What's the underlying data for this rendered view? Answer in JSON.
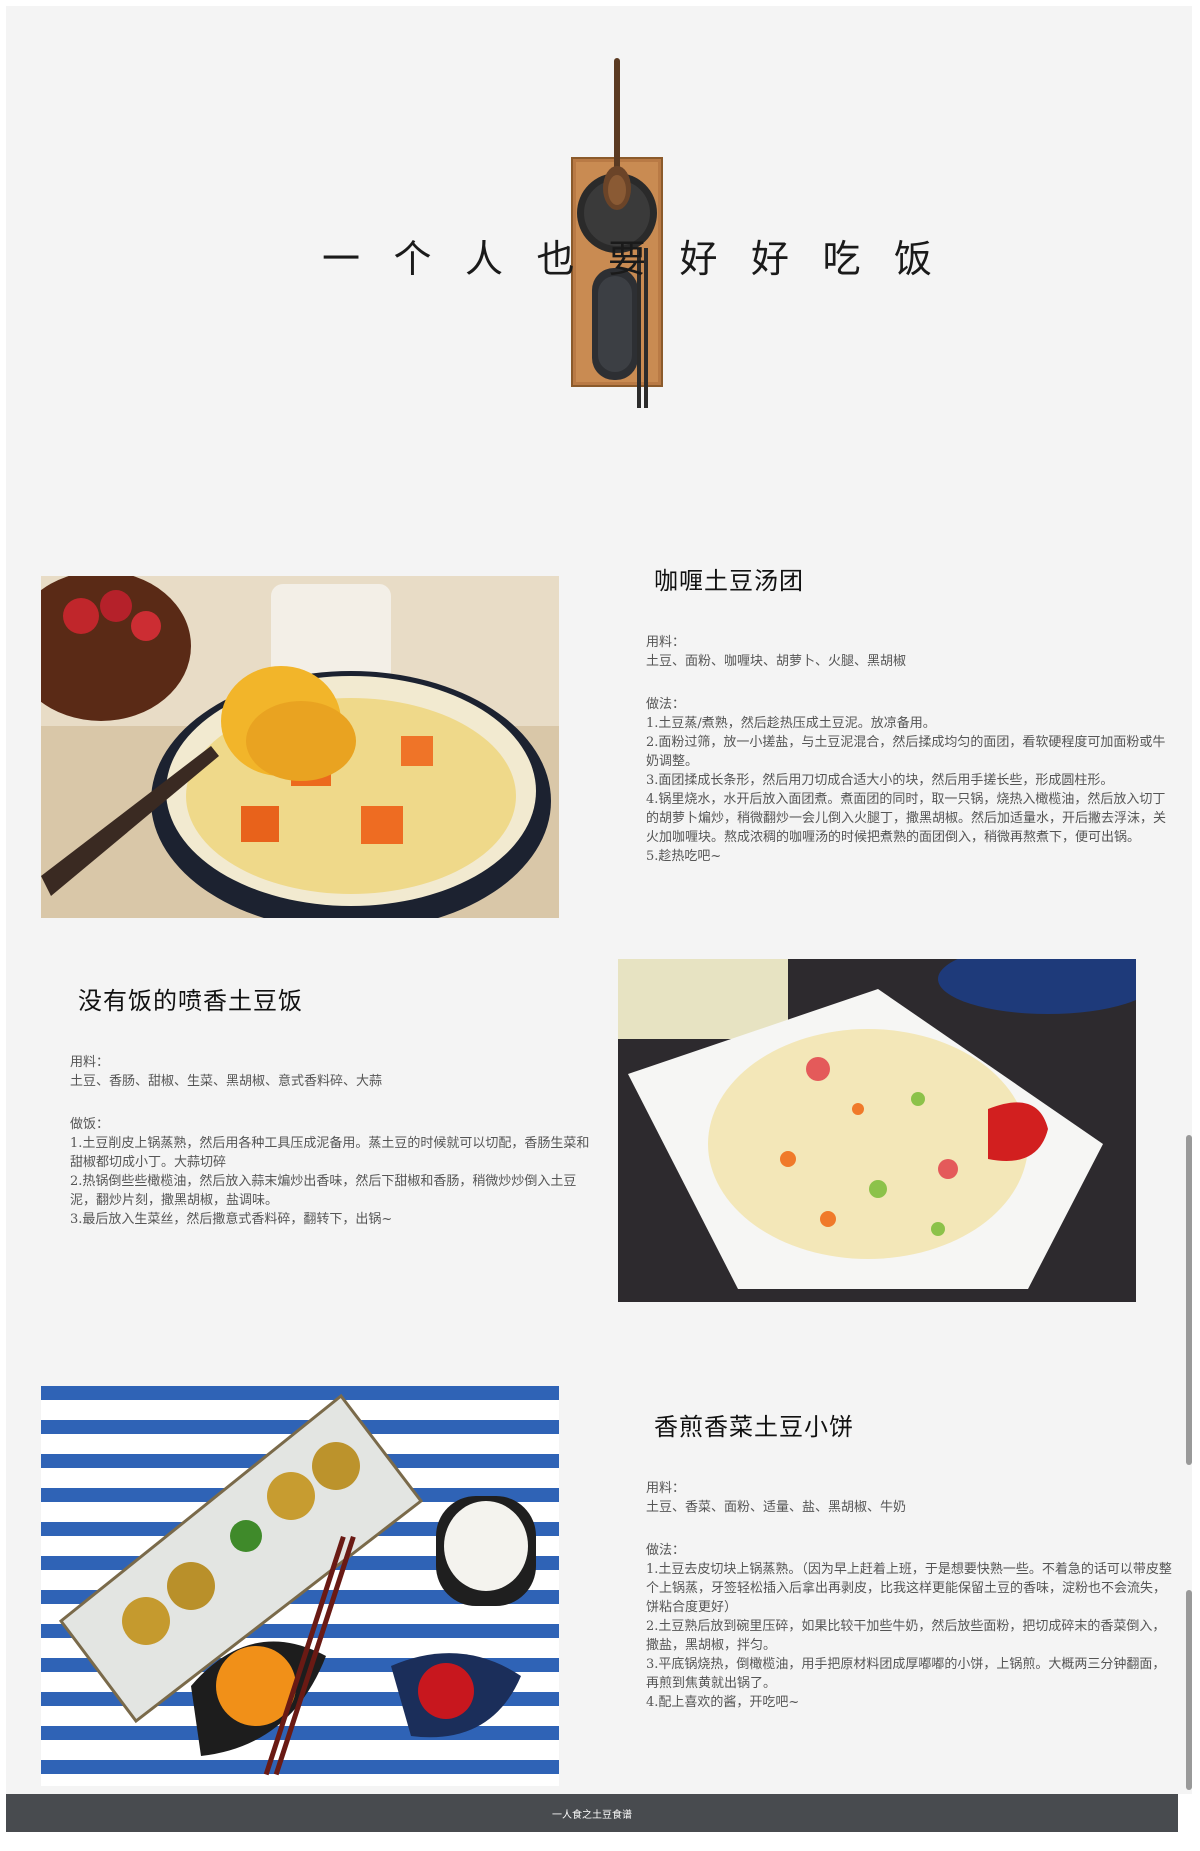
{
  "hero": {
    "title_chars": [
      "一",
      "个",
      "人",
      "也",
      "要",
      "好",
      "好",
      "吃",
      "饭"
    ]
  },
  "recipes": [
    {
      "title": "咖喱土豆汤团",
      "ingredients_label": "用料：",
      "ingredients": "土豆、面粉、咖喱块、胡萝卜、火腿、黑胡椒",
      "method_label": "做法：",
      "steps": [
        "1.土豆蒸/煮熟，然后趁热压成土豆泥。放凉备用。",
        "2.面粉过筛，放一小搓盐，与土豆泥混合，然后揉成均匀的面团，看软硬程度可加面粉或牛奶调整。",
        "3.面团揉成长条形，然后用刀切成合适大小的块，然后用手搓长些，形成圆柱形。",
        "4.锅里烧水，水开后放入面团煮。煮面团的同时，取一只锅，烧热入橄榄油，然后放入切丁的胡萝卜煸炒，稍微翻炒一会儿倒入火腿丁，撒黑胡椒。然后加适量水，开后撇去浮沫，关火加咖喱块。熬成浓稠的咖喱汤的时候把煮熟的面团倒入，稍微再熬煮下，便可出锅。",
        "5.趁热吃吧~"
      ]
    },
    {
      "title": "没有饭的喷香土豆饭",
      "ingredients_label": "用料：",
      "ingredients": "土豆、香肠、甜椒、生菜、黑胡椒、意式香料碎、大蒜",
      "method_label": "做饭：",
      "steps": [
        "1.土豆削皮上锅蒸熟，然后用各种工具压成泥备用。蒸土豆的时候就可以切配，香肠生菜和甜椒都切成小丁。大蒜切碎",
        "2.热锅倒些些橄榄油，然后放入蒜末煸炒出香味，然后下甜椒和香肠，稍微炒炒倒入土豆泥，翻炒片刻，撒黑胡椒，盐调味。",
        "3.最后放入生菜丝，然后撒意式香料碎，翻转下，出锅~"
      ]
    },
    {
      "title": "香煎香菜土豆小饼",
      "ingredients_label": "用料：",
      "ingredients": "土豆、香菜、面粉、适量、盐、黑胡椒、牛奶",
      "method_label": "做法：",
      "steps": [
        "1.土豆去皮切块上锅蒸熟。（因为早上赶着上班，于是想要快熟一些。不着急的话可以带皮整个上锅蒸，牙签轻松插入后拿出再剥皮，比我这样更能保留土豆的香味，淀粉也不会流失，饼粘合度更好）",
        "2.土豆熟后放到碗里压碎，如果比较干加些牛奶，然后放些面粉，把切成碎末的香菜倒入，撒盐，黑胡椒，拌匀。",
        "3.平底锅烧热，倒橄榄油，用手把原材料团成厚嘟嘟的小饼，上锅煎。大概两三分钟翻面，再煎到焦黄就出锅了。",
        "4.配上喜欢的酱，开吃吧~"
      ]
    }
  ],
  "footer": {
    "text": "一人食之土豆食谱"
  }
}
